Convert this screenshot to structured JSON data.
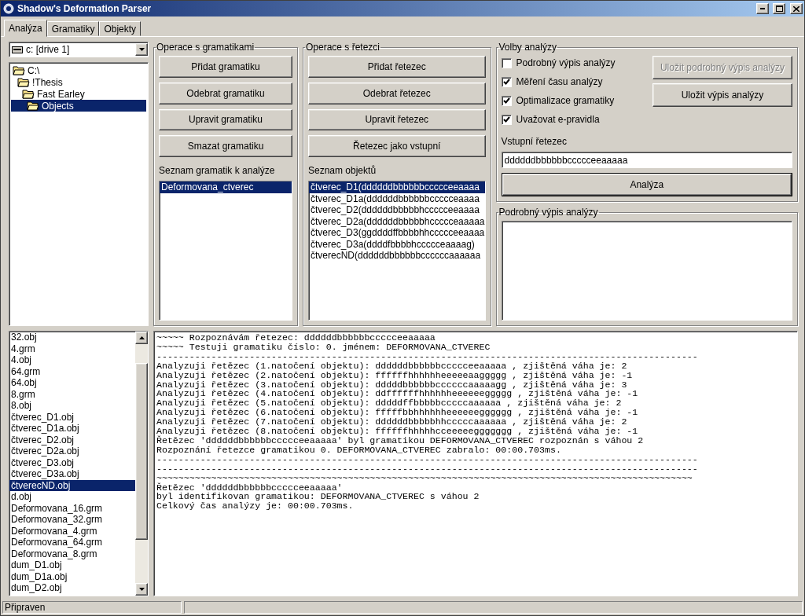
{
  "window": {
    "title": "Shadow's Deformation Parser"
  },
  "tabs": [
    {
      "label": "Analýza",
      "selected": true
    },
    {
      "label": "Gramatiky",
      "selected": false
    },
    {
      "label": "Objekty",
      "selected": false
    }
  ],
  "drive_select": {
    "value": "c: [drive 1]"
  },
  "folder_tree": [
    {
      "label": "C:\\",
      "selected": false,
      "children": [
        {
          "label": "!Thesis",
          "selected": false,
          "children": [
            {
              "label": "Fast Earley",
              "selected": false,
              "children": [
                {
                  "label": "Objects",
                  "selected": true
                }
              ]
            }
          ]
        }
      ]
    }
  ],
  "file_list": [
    {
      "label": "32.obj",
      "selected": false
    },
    {
      "label": "4.grm",
      "selected": false
    },
    {
      "label": "4.obj",
      "selected": false
    },
    {
      "label": "64.grm",
      "selected": false
    },
    {
      "label": "64.obj",
      "selected": false
    },
    {
      "label": "8.grm",
      "selected": false
    },
    {
      "label": "8.obj",
      "selected": false
    },
    {
      "label": "čtverec_D1.obj",
      "selected": false
    },
    {
      "label": "čtverec_D1a.obj",
      "selected": false
    },
    {
      "label": "čtverec_D2.obj",
      "selected": false
    },
    {
      "label": "čtverec_D2a.obj",
      "selected": false
    },
    {
      "label": "čtverec_D3.obj",
      "selected": false
    },
    {
      "label": "čtverec_D3a.obj",
      "selected": false
    },
    {
      "label": "čtverecND.obj",
      "selected": true
    },
    {
      "label": "d.obj",
      "selected": false
    },
    {
      "label": "Deformovana_16.grm",
      "selected": false
    },
    {
      "label": "Deformovana_32.grm",
      "selected": false
    },
    {
      "label": "Deformovana_4.grm",
      "selected": false
    },
    {
      "label": "Deformovana_64.grm",
      "selected": false
    },
    {
      "label": "Deformovana_8.grm",
      "selected": false
    },
    {
      "label": "dum_D1.obj",
      "selected": false
    },
    {
      "label": "dum_D1a.obj",
      "selected": false
    },
    {
      "label": "dum_D2.obj",
      "selected": false
    }
  ],
  "grammar_ops": {
    "title": "Operace s gramatikami",
    "buttons": [
      "Přidat gramatiku",
      "Odebrat gramatiku",
      "Upravit gramatiku",
      "Smazat gramatiku"
    ],
    "list_label": "Seznam gramatik k analýze",
    "list": [
      {
        "label": "Deformovana_ctverec",
        "selected": true
      }
    ]
  },
  "string_ops": {
    "title": "Operace s řetezci",
    "buttons": [
      "Přidat řetezec",
      "Odebrat řetezec",
      "Upravit řetezec",
      "Řetezec jako vstupní"
    ],
    "list_label": "Seznam objektů",
    "list": [
      {
        "label": "čtverec_D1(ddddddbbbbbbccccceeaaaa",
        "selected": true
      },
      {
        "label": "čtverec_D1a(ddddddbbbbbbccccceaaaa",
        "selected": false
      },
      {
        "label": "čtverec_D2(ddddddbbbbbhccccceeaaaa",
        "selected": false
      },
      {
        "label": "čtverec_D2a(ddddddbbbbbhccccceaaaaa",
        "selected": false
      },
      {
        "label": "čtverec_D3(ggddddffbbbbhhccccceeaaaa",
        "selected": false
      },
      {
        "label": "čtverec_D3a(ddddfbbbbhccccceaaaag)",
        "selected": false
      },
      {
        "label": "čtverecND(ddddddbbbbbbccccccaaaaaa",
        "selected": false
      }
    ]
  },
  "options": {
    "title": "Volby analýzy",
    "checkboxes": [
      {
        "label": "Podrobný výpis analýzy",
        "checked": false
      },
      {
        "label": "Měření času analýzy",
        "checked": true
      },
      {
        "label": "Optimalizace gramatiky",
        "checked": true
      },
      {
        "label": "Uvažovat e-pravidla",
        "checked": true
      }
    ],
    "buttons": [
      {
        "label": "Uložit podrobný výpis analýzy",
        "disabled": true
      },
      {
        "label": "Uložit výpis analýzy",
        "disabled": false
      }
    ],
    "input_label": "Vstupní řetezec",
    "input_value": "ddddddbbbbbbccccceeaaaaa",
    "analyze_button": "Analýza"
  },
  "detail": {
    "title": "Podrobný výpis analýzy"
  },
  "log": [
    "~~~~~ Rozpoznávám řetezec: ddddddbbbbbbccccceeaaaaa",
    "~~~~~ Testuji gramatiku číslo: 0. jménem: DEFORMOVANA_CTVEREC",
    "---------------------------------------------------------------------------------------------------",
    "Analyzuji řetězec (1.natočení objektu): ddddddbbbbbbccccceeaaaaa , zjištěná váha je: 2",
    "Analyzuji řetězec (2.natočení objektu): ffffffhhhhhheeeeeaaggggg , zjištěná váha je: -1",
    "Analyzuji řetězec (3.natočení objektu): dddddbbbbbbccccccaaaaagg , zjištěná váha je: 3",
    "Analyzuji řetězec (4.natočení objektu): ddffffffhhhhhheeeeeeggggg , zjištěná váha je: -1",
    "Analyzuji řetězec (5.natočení objektu): dddddffbbbbbcccccaaaaaa , zjištěná váha je: 2",
    "Analyzuji řetězec (6.natočení objektu): fffffbbhhhhhheeeeeegggggg , zjištěná váha je: -1",
    "Analyzuji řetězec (7.natočení objektu): ddddddbbbbbhhcccccaaaaaa , zjištěná váha je: 2",
    "Analyzuji řetězec (8.natočení objektu): ffffffhhhhhcceeeeeggggggg , zjištěná váha je: -1",
    "Řetězec 'ddddddbbbbbbccccceeaaaaa' byl gramatikou DEFORMOVANA_CTVEREC rozpoznán s váhou 2",
    "Rozpoznání řetezce gramatikou 0. DEFORMOVANA_CTVEREC zabralo: 00:00.703ms.",
    "---------------------------------------------------------------------------------------------------",
    "---------------------------------------------------------------------------------------------------",
    "~~~~~~~~~~~~~~~~~~~~~~~~~~~~~~~~~~~~~~~~~~~~~~~~~~~~~~~~~~~~~~~~~~~~~~~~~~~~~~~~~~~~~~~~~~~~~~~~~~",
    "Řetězec 'ddddddbbbbbbccccceeaaaaa'",
    "byl identifikovan gramatikou: DEFORMOVANA_CTVEREC s váhou 2",
    "Celkový čas analýzy je: 00:00.703ms."
  ],
  "status_bar": [
    "Připraven"
  ]
}
